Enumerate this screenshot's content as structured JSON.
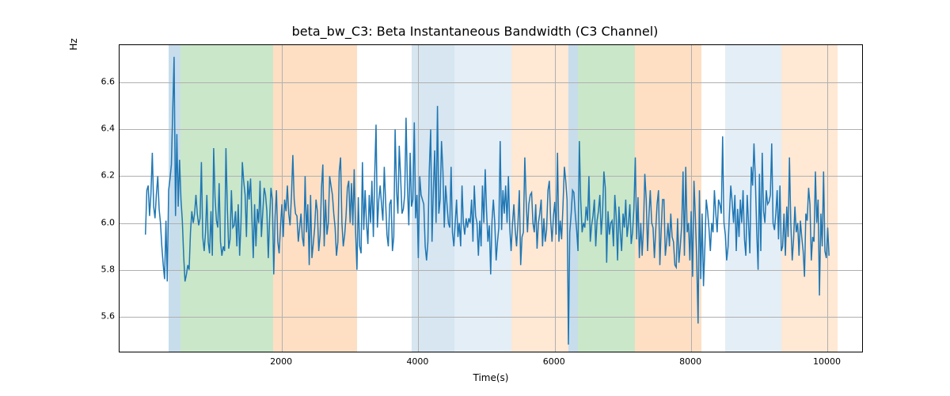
{
  "chart_data": {
    "type": "line",
    "title": "beta_bw_C3: Beta Instantaneous Bandwidth (C3 Channel)",
    "xlabel": "Time(s)",
    "ylabel": "Hz",
    "xlim": [
      -380,
      10505
    ],
    "ylim": [
      5.45,
      6.76
    ],
    "xticks": [
      2000,
      4000,
      6000,
      8000,
      10000
    ],
    "yticks": [
      5.6,
      5.8,
      6.0,
      6.2,
      6.4,
      6.6
    ],
    "spans": [
      {
        "start": 340,
        "end": 510,
        "color": "#1f77b4",
        "alpha": 0.25
      },
      {
        "start": 510,
        "end": 1870,
        "color": "#2ca02c",
        "alpha": 0.25
      },
      {
        "start": 1870,
        "end": 3100,
        "color": "#ff7f0e",
        "alpha": 0.25
      },
      {
        "start": 3900,
        "end": 4530,
        "color": "#1f77b4",
        "alpha": 0.18
      },
      {
        "start": 4530,
        "end": 5360,
        "color": "#1f77b4",
        "alpha": 0.12
      },
      {
        "start": 5360,
        "end": 6200,
        "color": "#ff7f0e",
        "alpha": 0.18
      },
      {
        "start": 6200,
        "end": 6340,
        "color": "#1f77b4",
        "alpha": 0.25
      },
      {
        "start": 6340,
        "end": 7180,
        "color": "#2ca02c",
        "alpha": 0.25
      },
      {
        "start": 7180,
        "end": 8150,
        "color": "#ff7f0e",
        "alpha": 0.25
      },
      {
        "start": 8500,
        "end": 9320,
        "color": "#1f77b4",
        "alpha": 0.12
      },
      {
        "start": 9320,
        "end": 10150,
        "color": "#ff7f0e",
        "alpha": 0.18
      }
    ],
    "series": [
      {
        "name": "beta_bw_C3",
        "color": "#1f77b4",
        "x_step": 20,
        "x_start": 0,
        "y": [
          5.95,
          6.14,
          6.16,
          6.03,
          6.12,
          6.3,
          6.07,
          6.02,
          6.12,
          6.2,
          6.06,
          6.0,
          5.9,
          5.82,
          5.76,
          6.01,
          5.75,
          6.14,
          6.19,
          6.25,
          6.48,
          6.71,
          6.03,
          6.38,
          6.07,
          6.27,
          6.1,
          6.01,
          5.86,
          5.75,
          5.78,
          5.82,
          5.8,
          5.96,
          6.05,
          6.0,
          6.04,
          6.12,
          6.04,
          5.99,
          6.02,
          6.26,
          5.94,
          5.88,
          5.96,
          6.12,
          5.92,
          5.87,
          6.05,
          5.86,
          6.32,
          6.11,
          6.01,
          5.98,
          6.17,
          5.92,
          5.86,
          5.9,
          5.88,
          6.32,
          6.06,
          5.89,
          5.93,
          6.14,
          5.98,
          5.99,
          6.05,
          5.9,
          6.08,
          5.86,
          6.0,
          6.26,
          6.18,
          6.12,
          5.94,
          6.18,
          6.1,
          6.19,
          6.02,
          5.85,
          6.08,
          5.9,
          6.06,
          6.0,
          6.18,
          5.94,
          6.05,
          6.15,
          6.12,
          6.05,
          5.85,
          6.02,
          6.15,
          6.1,
          5.78,
          6.03,
          6.14,
          5.92,
          5.87,
          5.99,
          6.08,
          5.94,
          6.1,
          6.05,
          6.16,
          6.04,
          5.99,
          6.12,
          6.29,
          6.1,
          6.04,
          6.03,
          5.92,
          5.98,
          6.04,
          5.94,
          5.9,
          6.2,
          5.96,
          6.08,
          5.82,
          6.12,
          5.85,
          5.91,
          5.98,
          6.1,
          6.05,
          5.88,
          5.95,
          6.15,
          6.25,
          5.9,
          6.1,
          5.95,
          6.0,
          6.2,
          6.16,
          6.12,
          6.04,
          5.98,
          5.86,
          5.92,
          6.22,
          6.28,
          6.0,
          5.9,
          5.95,
          6.03,
          6.15,
          6.18,
          6.0,
          6.17,
          5.99,
          6.23,
          5.96,
          5.8,
          6.11,
          5.9,
          5.87,
          6.26,
          5.97,
          6.14,
          6.0,
          5.91,
          6.12,
          6.0,
          6.18,
          5.94,
          6.2,
          6.42,
          5.98,
          6.1,
          6.16,
          6.08,
          6.01,
          6.24,
          6.09,
          5.95,
          5.9,
          6.08,
          6.1,
          5.88,
          5.94,
          6.4,
          6.14,
          6.04,
          6.33,
          6.2,
          6.04,
          6.06,
          6.12,
          6.45,
          6.15,
          5.99,
          6.3,
          6.07,
          6.1,
          6.43,
          6.02,
          6.12,
          5.85,
          6.2,
          6.12,
          6.1,
          6.08,
          5.9,
          5.84,
          5.92,
          6.22,
          6.4,
          5.92,
          6.14,
          6.31,
          6.0,
          6.5,
          6.04,
          6.1,
          6.35,
          6.22,
          5.98,
          6.16,
          6.08,
          6.0,
          5.98,
          6.24,
          5.96,
          5.9,
          6.0,
          6.1,
          5.94,
          6.0,
          5.9,
          6.16,
          6.0,
          5.95,
          6.02,
          5.98,
          6.02,
          6.0,
          6.1,
          5.92,
          6.16,
          6.03,
          6.0,
          5.86,
          6.01,
          5.9,
          6.16,
          6.0,
          6.23,
          6.05,
          5.92,
          5.99,
          5.78,
          6.01,
          6.1,
          6.0,
          5.84,
          5.92,
          5.98,
          6.35,
          5.97,
          6.14,
          6.04,
          6.16,
          6.0,
          6.2,
          5.98,
          5.88,
          6.0,
          6.08,
          5.97,
          5.9,
          6.0,
          6.14,
          5.82,
          5.94,
          5.96,
          6.28,
          6.1,
          5.96,
          6.08,
          6.12,
          6.13,
          6.0,
          5.96,
          6.08,
          5.89,
          6.0,
          6.04,
          6.1,
          5.9,
          6.02,
          5.92,
          5.97,
          6.14,
          6.18,
          6.01,
          5.92,
          6.03,
          6.09,
          5.95,
          6.3,
          5.92,
          6.01,
          5.93,
          6.07,
          6.24,
          6.18,
          6.1,
          5.48,
          5.96,
          6.04,
          6.14,
          6.13,
          6.04,
          5.97,
          5.88,
          6.35,
          6.1,
          5.96,
          6.0,
          5.98,
          6.07,
          6.01,
          6.2,
          5.92,
          5.99,
          6.03,
          6.1,
          5.9,
          6.01,
          6.05,
          6.12,
          5.95,
          6.04,
          6.22,
          6.15,
          5.83,
          6.05,
          5.95,
          6.0,
          6.01,
          5.9,
          6.12,
          6.03,
          5.84,
          6.07,
          5.96,
          5.88,
          6.04,
          5.98,
          6.1,
          5.94,
          6.0,
          6.08,
          5.91,
          5.96,
          6.06,
          6.28,
          5.93,
          6.11,
          5.85,
          6.0,
          5.86,
          5.98,
          6.21,
          6.1,
          5.88,
          6.03,
          6.14,
          6.0,
          5.98,
          5.85,
          5.97,
          6.08,
          6.14,
          5.82,
          5.97,
          6.1,
          6.1,
          5.86,
          5.92,
          6.0,
          5.9,
          6.04,
          5.94,
          5.92,
          5.82,
          5.81,
          6.02,
          5.83,
          5.9,
          5.99,
          6.22,
          5.86,
          6.24,
          5.96,
          6.0,
          5.84,
          6.05,
          5.77,
          6.18,
          6.03,
          5.85,
          5.57,
          6.14,
          5.76,
          6.04,
          5.73,
          5.9,
          6.1,
          6.05,
          5.98,
          5.88,
          6.0,
          5.96,
          6.14,
          6.04,
          5.96,
          6.1,
          6.08,
          6.04,
          6.37,
          6.0,
          5.95,
          5.84,
          5.9,
          6.04,
          6.16,
          6.09,
          6.0,
          6.12,
          5.88,
          6.06,
          5.94,
          6.1,
          6.0,
          6.14,
          5.93,
          5.86,
          6.12,
          6.0,
          5.87,
          6.24,
          6.16,
          6.34,
          6.19,
          5.96,
          5.8,
          6.21,
          5.88,
          6.3,
          6.05,
          6.0,
          6.14,
          6.08,
          6.09,
          6.12,
          6.34,
          6.0,
          5.97,
          6.04,
          6.14,
          5.93,
          6.16,
          5.88,
          5.9,
          6.04,
          5.86,
          6.07,
          5.94,
          6.28,
          6.0,
          5.84,
          5.93,
          6.07,
          5.96,
          6.0,
          5.86,
          6.01,
          5.94,
          5.88,
          5.77,
          6.04,
          6.01,
          6.15,
          6.08,
          5.84,
          5.94,
          5.92,
          6.22,
          6.0,
          6.1,
          5.69,
          6.04,
          5.9,
          6.22,
          5.88,
          5.85,
          5.98,
          5.86
        ]
      }
    ]
  }
}
